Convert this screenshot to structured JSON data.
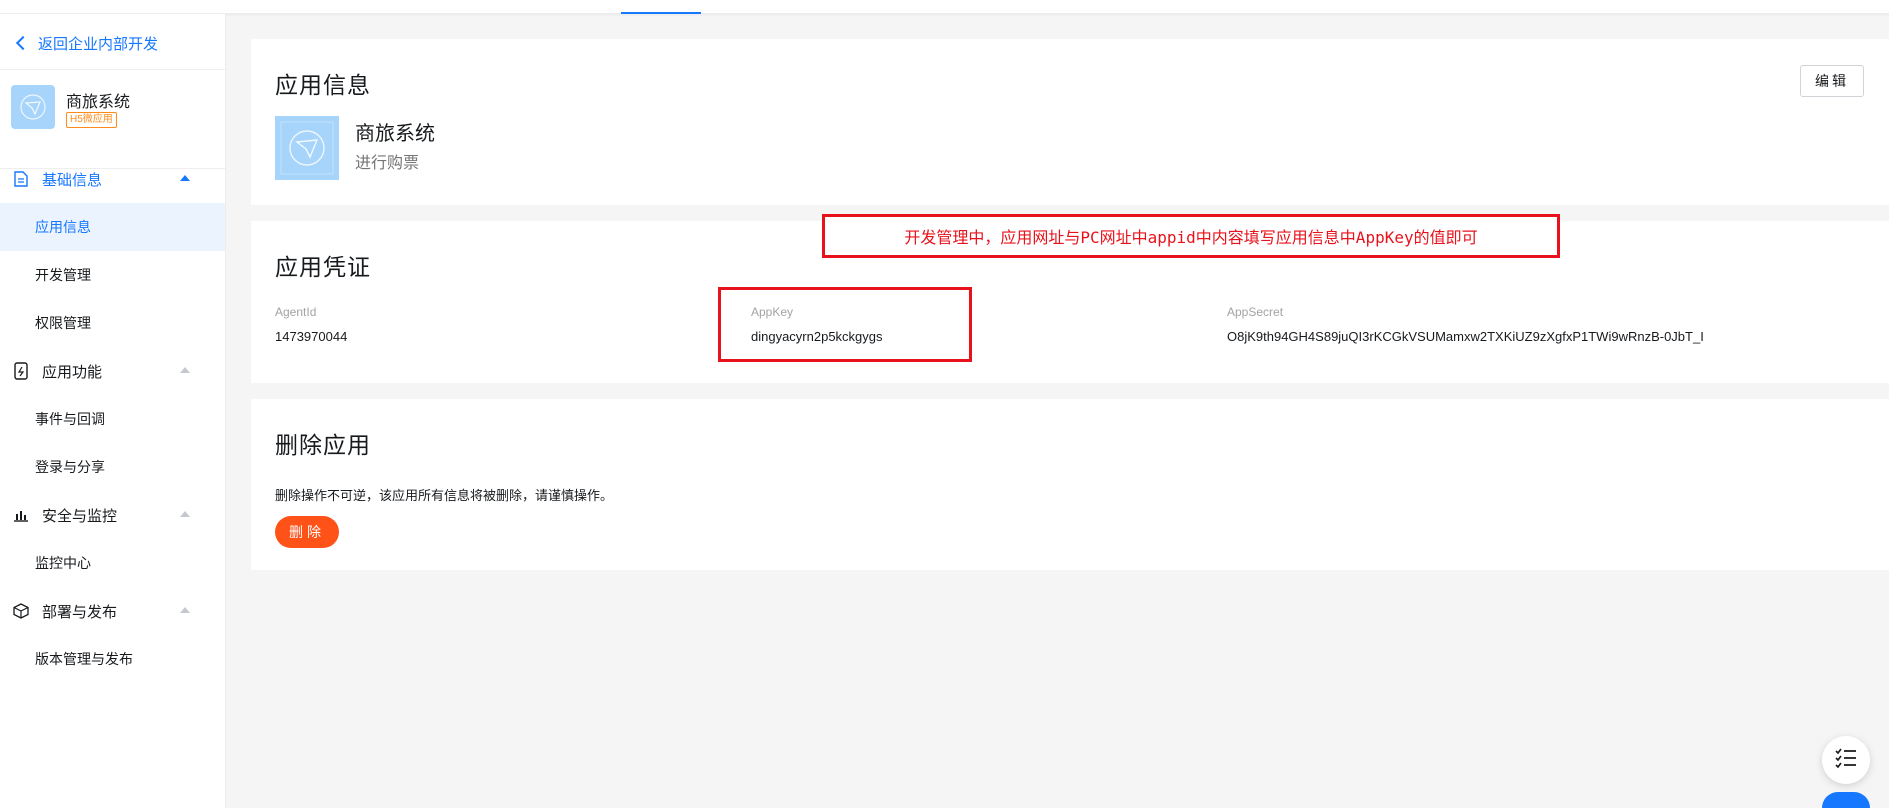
{
  "sidebar": {
    "back_label": "返回企业内部开发",
    "app_name": "商旅系统",
    "app_tag": "H5微应用",
    "groups": [
      {
        "label": "基础信息",
        "icon": "document-icon",
        "items": [
          "应用信息",
          "开发管理",
          "权限管理"
        ]
      },
      {
        "label": "应用功能",
        "icon": "app-function-icon",
        "items": [
          "事件与回调",
          "登录与分享"
        ]
      },
      {
        "label": "安全与监控",
        "icon": "bar-chart-icon",
        "items": [
          "监控中心"
        ]
      },
      {
        "label": "部署与发布",
        "icon": "cube-icon",
        "items": [
          "版本管理与发布"
        ]
      }
    ],
    "active_item": "应用信息"
  },
  "app_info": {
    "title": "应用信息",
    "edit_label": "编辑",
    "name": "商旅系统",
    "description": "进行购票"
  },
  "credentials": {
    "title": "应用凭证",
    "agent_id_label": "AgentId",
    "agent_id": "1473970044",
    "app_key_label": "AppKey",
    "app_key": "dingyacyrn2p5kckgygs",
    "app_secret_label": "AppSecret",
    "app_secret": "O8jK9th94GH4S89juQI3rKCGkVSUMamxw2TXKiUZ9zXgfxP1TWi9wRnzB-0JbT_I"
  },
  "delete": {
    "title": "删除应用",
    "warning": "删除操作不可逆，该应用所有信息将被删除，请谨慎操作。",
    "button_label": "删除"
  },
  "annotation": {
    "text": "开发管理中，应用网址与PC网址中appid中内容填写应用信息中AppKey的值即可"
  },
  "colors": {
    "accent": "#1677ff",
    "danger": "#ff5219",
    "annotation_red": "#e8121c",
    "tag_orange": "#ff8b1a",
    "app_icon_bg": "#a7d4fb"
  }
}
